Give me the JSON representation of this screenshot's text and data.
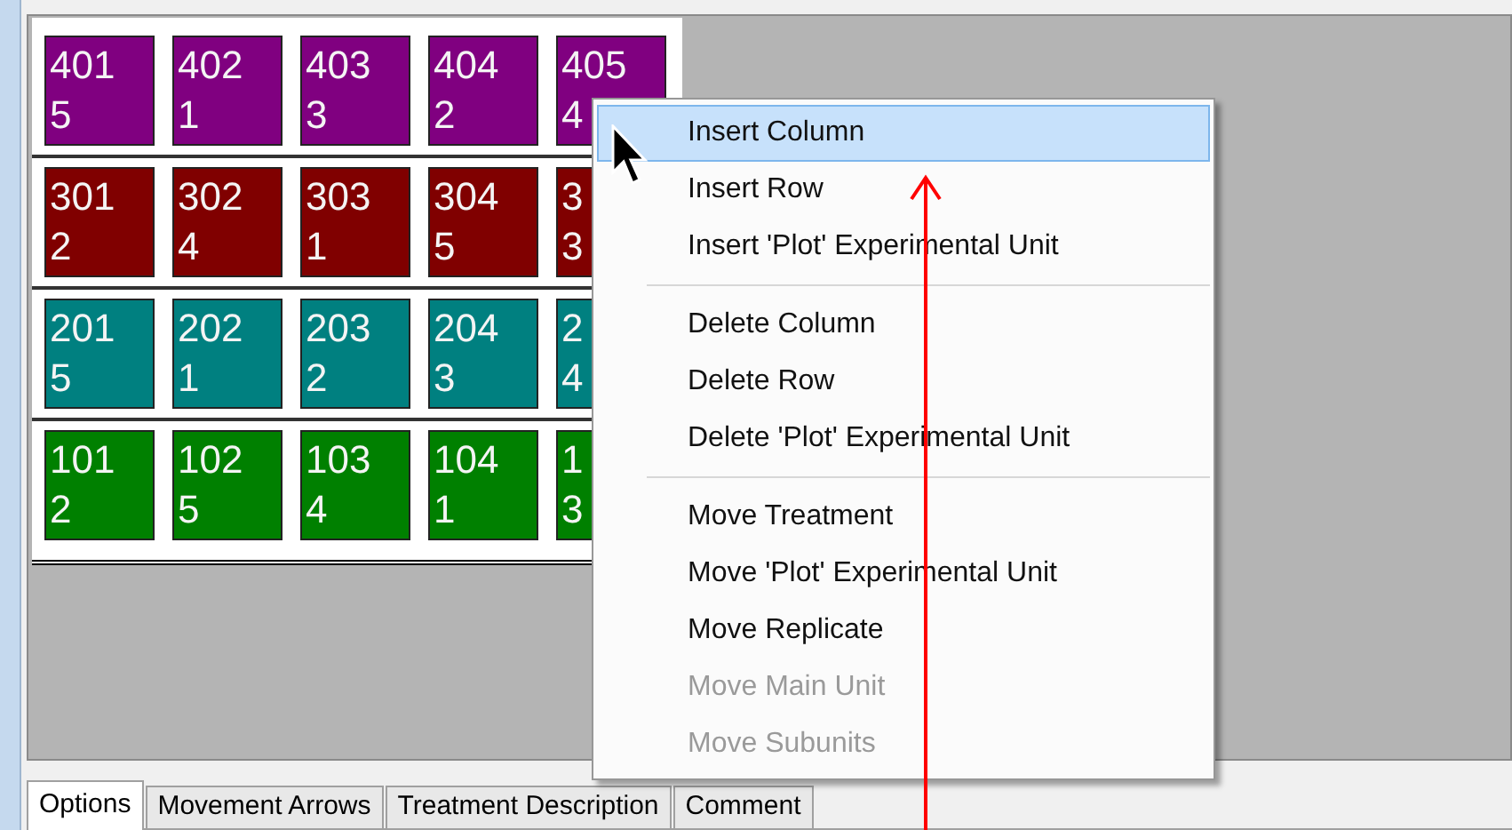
{
  "grid": {
    "rows": [
      {
        "color": "#800080",
        "tiles": [
          {
            "line_1": "401",
            "line_2": "5"
          },
          {
            "line_1": "402",
            "line_2": "1"
          },
          {
            "line_1": "403",
            "line_2": "3"
          },
          {
            "line_1": "404",
            "line_2": "2"
          },
          {
            "line_1": "405",
            "line_2": "4"
          }
        ]
      },
      {
        "color": "#800000",
        "tiles": [
          {
            "line_1": "301",
            "line_2": "2"
          },
          {
            "line_1": "302",
            "line_2": "4"
          },
          {
            "line_1": "303",
            "line_2": "1"
          },
          {
            "line_1": "304",
            "line_2": "5"
          },
          {
            "line_1": "3",
            "line_2": "3"
          }
        ]
      },
      {
        "color": "#008080",
        "tiles": [
          {
            "line_1": "201",
            "line_2": "5"
          },
          {
            "line_1": "202",
            "line_2": "1"
          },
          {
            "line_1": "203",
            "line_2": "2"
          },
          {
            "line_1": "204",
            "line_2": "3"
          },
          {
            "line_1": "2",
            "line_2": "4"
          }
        ]
      },
      {
        "color": "#008000",
        "tiles": [
          {
            "line_1": "101",
            "line_2": "2"
          },
          {
            "line_1": "102",
            "line_2": "5"
          },
          {
            "line_1": "103",
            "line_2": "4"
          },
          {
            "line_1": "104",
            "line_2": "1"
          },
          {
            "line_1": "1",
            "line_2": "3"
          }
        ]
      }
    ]
  },
  "context_menu": {
    "groups": [
      [
        {
          "label": "Insert Column",
          "selected": true,
          "disabled": false
        },
        {
          "label": "Insert Row",
          "selected": false,
          "disabled": false
        },
        {
          "label": "Insert 'Plot' Experimental Unit",
          "selected": false,
          "disabled": false
        }
      ],
      [
        {
          "label": "Delete Column",
          "selected": false,
          "disabled": false
        },
        {
          "label": "Delete Row",
          "selected": false,
          "disabled": false
        },
        {
          "label": "Delete 'Plot' Experimental Unit",
          "selected": false,
          "disabled": false
        }
      ],
      [
        {
          "label": "Move Treatment",
          "selected": false,
          "disabled": false
        },
        {
          "label": "Move 'Plot' Experimental Unit",
          "selected": false,
          "disabled": false
        },
        {
          "label": "Move Replicate",
          "selected": false,
          "disabled": false
        },
        {
          "label": "Move Main Unit",
          "selected": false,
          "disabled": true
        },
        {
          "label": "Move Subunits",
          "selected": false,
          "disabled": true
        }
      ]
    ]
  },
  "tabs": [
    {
      "label": "Options",
      "selected": true
    },
    {
      "label": "Movement Arrows",
      "selected": false
    },
    {
      "label": "Treatment Description",
      "selected": false
    },
    {
      "label": "Comment",
      "selected": false
    }
  ]
}
